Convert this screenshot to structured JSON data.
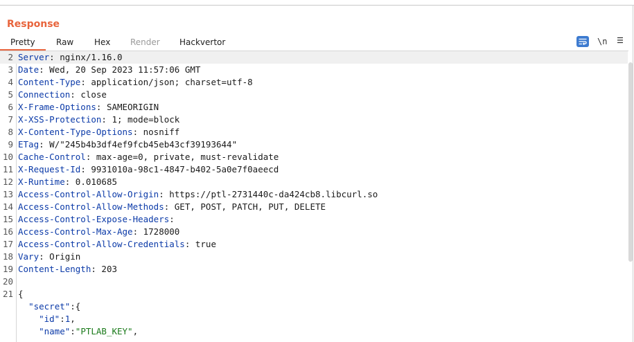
{
  "panel": {
    "title": "Response"
  },
  "tabs": [
    {
      "label": "Pretty",
      "selected": true,
      "enabled": true
    },
    {
      "label": "Raw",
      "enabled": true
    },
    {
      "label": "Hex",
      "enabled": true
    },
    {
      "label": "Render",
      "enabled": false
    },
    {
      "label": "Hackvertor",
      "enabled": true
    }
  ],
  "toolbar": {
    "wrap_icon": "word-wrap-icon",
    "newline_label": "\\n",
    "menu_icon": "hamburger-menu-icon",
    "accent_color": "#3d7bd0"
  },
  "colors": {
    "brand": "#e8643c",
    "header_key": "#0b3aa8",
    "json_string": "#1a7a1a"
  },
  "lines": [
    {
      "n": "2",
      "key": "Server",
      "value": " nginx/1.16.0"
    },
    {
      "n": "3",
      "key": "Date",
      "value": " Wed, 20 Sep 2023 11:57:06 GMT"
    },
    {
      "n": "4",
      "key": "Content-Type",
      "value": " application/json; charset=utf-8"
    },
    {
      "n": "5",
      "key": "Connection",
      "value": " close"
    },
    {
      "n": "6",
      "key": "X-Frame-Options",
      "value": " SAMEORIGIN"
    },
    {
      "n": "7",
      "key": "X-XSS-Protection",
      "value": " 1; mode=block"
    },
    {
      "n": "8",
      "key": "X-Content-Type-Options",
      "value": " nosniff"
    },
    {
      "n": "9",
      "key": "ETag",
      "value": " W/\"245b4b3df4ef9fcb45eb43cf39193644\""
    },
    {
      "n": "10",
      "key": "Cache-Control",
      "value": " max-age=0, private, must-revalidate"
    },
    {
      "n": "11",
      "key": "X-Request-Id",
      "value": " 9931010a-98c1-4847-b402-5a0e7f0aeecd"
    },
    {
      "n": "12",
      "key": "X-Runtime",
      "value": " 0.010685"
    },
    {
      "n": "13",
      "key": "Access-Control-Allow-Origin",
      "value": " https://ptl-2731440c-da424cb8.libcurl.so"
    },
    {
      "n": "14",
      "key": "Access-Control-Allow-Methods",
      "value": " GET, POST, PATCH, PUT, DELETE"
    },
    {
      "n": "15",
      "key": "Access-Control-Expose-Headers",
      "value": ""
    },
    {
      "n": "16",
      "key": "Access-Control-Max-Age",
      "value": " 1728000"
    },
    {
      "n": "17",
      "key": "Access-Control-Allow-Credentials",
      "value": " true"
    },
    {
      "n": "18",
      "key": "Vary",
      "value": " Origin"
    },
    {
      "n": "19",
      "key": "Content-Length",
      "value": " 203"
    },
    {
      "n": "20",
      "key": "",
      "value": ""
    },
    {
      "n": "21",
      "key": "",
      "value": "{"
    },
    {
      "n": "",
      "json": true,
      "indent": "  ",
      "k": "\"secret\"",
      "sep": ":{",
      "v": "",
      "tail": ""
    },
    {
      "n": "",
      "json": true,
      "indent": "    ",
      "k": "\"id\"",
      "sep": ":",
      "v": "1",
      "tail": ",",
      "vnum": true
    },
    {
      "n": "",
      "json": true,
      "indent": "    ",
      "k": "\"name\"",
      "sep": ":",
      "v": "\"PTLAB_KEY\"",
      "tail": ","
    }
  ]
}
